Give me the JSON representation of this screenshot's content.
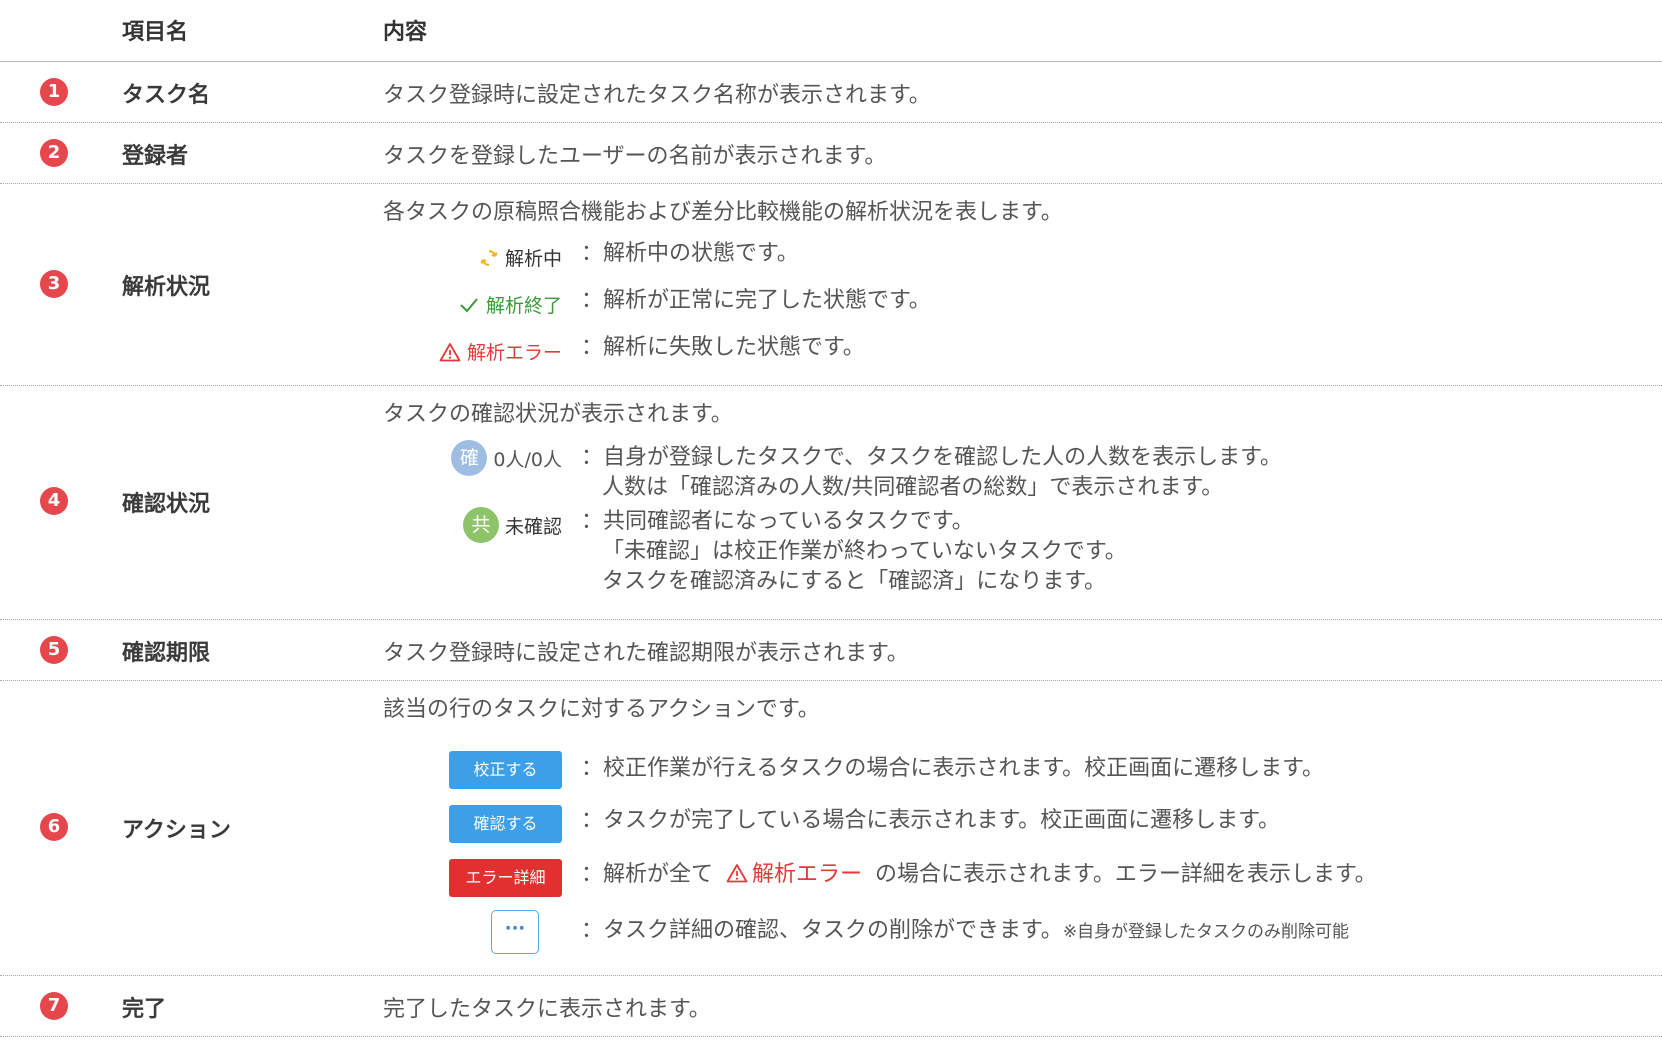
{
  "header": {
    "col_name": "項目名",
    "col_content": "内容"
  },
  "rows": [
    {
      "number": "1",
      "label": "タスク名",
      "description": "タスク登録時に設定されたタスク名称が表示されます。"
    },
    {
      "number": "2",
      "label": "登録者",
      "description": "タスクを登録したユーザーの名前が表示されます。"
    },
    {
      "number": "3",
      "label": "解析状況",
      "description": "各タスクの原稿照合機能および差分比較機能の解析状況を表します。",
      "items": [
        {
          "status": "解析中",
          "icon": "sync-icon",
          "text": "：解析中の状態です。"
        },
        {
          "status": "解析終了",
          "icon": "check-icon",
          "text": "：解析が正常に完了した状態です。"
        },
        {
          "status": "解析エラー",
          "icon": "warning-icon",
          "text": "：解析に失敗した状態です。"
        }
      ]
    },
    {
      "number": "4",
      "label": "確認状況",
      "description": "タスクの確認状況が表示されます。",
      "items": [
        {
          "badge": "確",
          "status": "0人/0人",
          "lines": [
            "：自身が登録したタスクで、タスクを確認した人の人数を表示します。",
            "人数は「確認済みの人数/共同確認者の総数」で表示されます。"
          ]
        },
        {
          "badge": "共",
          "status": "未確認",
          "lines": [
            "：共同確認者になっているタスクです。",
            "「未確認」は校正作業が終わっていないタスクです。",
            "タスクを確認済みにすると「確認済」になります。"
          ]
        }
      ]
    },
    {
      "number": "5",
      "label": "確認期限",
      "description": "タスク登録時に設定された確認期限が表示されます。"
    },
    {
      "number": "6",
      "label": "アクション",
      "description": "該当の行のタスクに対するアクションです。",
      "items": [
        {
          "button": "校正する",
          "text": "：校正作業が行えるタスクの場合に表示されます。校正画面に遷移します。"
        },
        {
          "button": "確認する",
          "text": "：タスクが完了している場合に表示されます。校正画面に遷移します。"
        },
        {
          "button": "エラー詳細",
          "text_before": "：解析が全て",
          "inline_status": "解析エラー",
          "text_after": "の場合に表示されます。エラー詳細を表示します。"
        },
        {
          "button": "···",
          "text": "：タスク詳細の確認、タスクの削除ができます。",
          "note": "※自身が登録したタスクのみ削除可能"
        }
      ]
    },
    {
      "number": "7",
      "label": "完了",
      "description": "完了したタスクに表示されます。"
    }
  ],
  "colors": {
    "number_badge": "#e6474c",
    "button_blue": "#3c9fe8",
    "button_red": "#e23030",
    "status_done": "#3a9a3a",
    "status_error": "#e23a3a",
    "badge_blue": "#9fbde2",
    "badge_green": "#8dc46a"
  }
}
